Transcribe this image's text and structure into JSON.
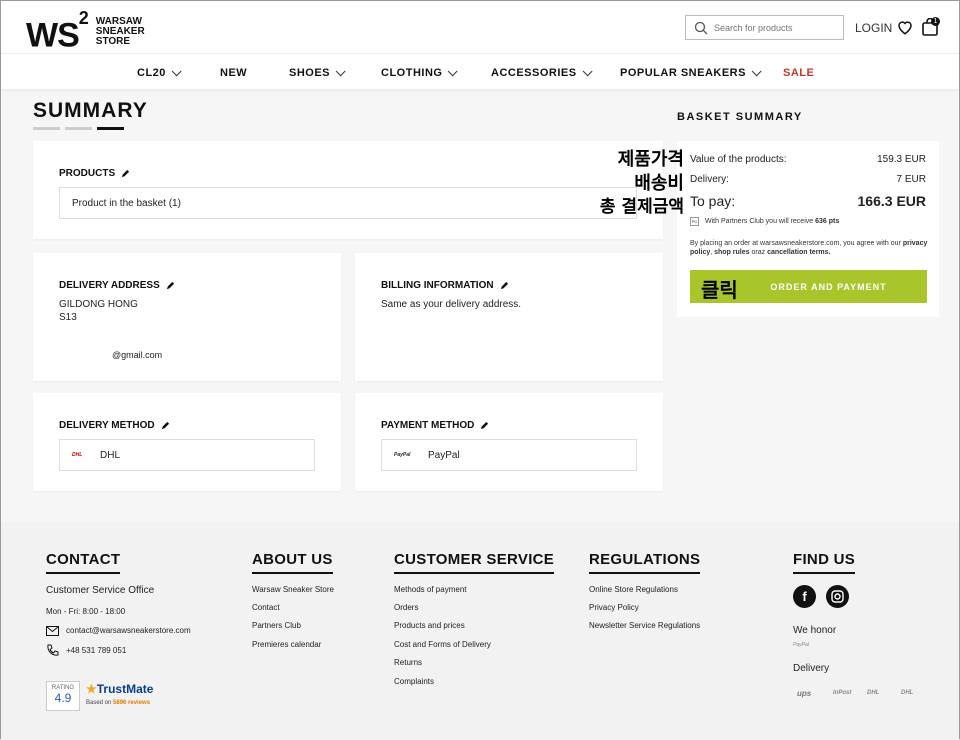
{
  "header": {
    "logo_mark": "WS",
    "logo_sup": "2",
    "logo_line1": "WARSAW",
    "logo_line2": "SNEAKER",
    "logo_line3": "STORE",
    "search_placeholder": "Search for products",
    "login": "LOGIN",
    "cart_count": "1"
  },
  "nav": {
    "items": [
      "CL20",
      "NEW",
      "SHOES",
      "CLOTHING",
      "ACCESSORIES",
      "POPULAR SNEAKERS",
      "SALE"
    ]
  },
  "summary": {
    "title": "SUMMARY",
    "products_title": "PRODUCTS",
    "products_box": "Product in the basket (1)",
    "delivery_address_title": "DELIVERY ADDRESS",
    "delivery_name": "GILDONG HONG",
    "delivery_line2": "S13",
    "delivery_email": "@gmail.com",
    "billing_title": "BILLING INFORMATION",
    "billing_text": "Same as your delivery address.",
    "delivery_method_title": "DELIVERY METHOD",
    "delivery_method_logo": "DHL",
    "delivery_method": "DHL",
    "payment_method_title": "PAYMENT METHOD",
    "payment_method_logo": "PayPal",
    "payment_method": "PayPal"
  },
  "basket": {
    "title": "BASKET SUMMARY",
    "value_label": "Value of the products:",
    "value_amount": "159.3 EUR",
    "delivery_label": "Delivery:",
    "delivery_amount": "7 EUR",
    "topay_label": "To pay:",
    "topay_amount": "166.3 EUR",
    "pc_icon": "PC",
    "partners_note_prefix": "With Partners Club you will receive",
    "partners_points": "636 pts",
    "agree_prefix": "By placing an order at warsawsneakerstore.com, you agree with our",
    "agree_privacy": "privacy policy",
    "agree_rules": "shop rules",
    "agree_oraz": "oraz",
    "agree_cancel": "cancellation terms.",
    "order_button": "ORDER AND PAYMENT"
  },
  "annotations": {
    "price_kr": "제품가격",
    "shipping_kr": "배송비",
    "total_kr": "총 결제금액",
    "click_kr": "클릭"
  },
  "footer": {
    "contact_title": "CONTACT",
    "contact_office": "Customer Service Office",
    "contact_hours": "Mon - Fri: 8:00 - 18:00",
    "contact_email": "contact@warsawsneakerstore.com",
    "contact_phone": "+48 531 789 051",
    "about_title": "ABOUT US",
    "about_links": [
      "Warsaw Sneaker Store",
      "Contact",
      "Partners Club",
      "Premieres calendar"
    ],
    "cs_title": "CUSTOMER SERVICE",
    "cs_links": [
      "Methods of payment",
      "Orders",
      "Products and prices",
      "Cost and Forms of Delivery",
      "Returns",
      "Complaints"
    ],
    "reg_title": "REGULATIONS",
    "reg_links": [
      "Online Store Regulations",
      "Privacy Policy",
      "Newsletter Service Regulations"
    ],
    "find_title": "FIND US",
    "we_honor": "We honor",
    "paypal_small": "PayPal",
    "delivery_label": "Delivery",
    "carriers": [
      "ups",
      "InPost",
      "DHL",
      "DHL"
    ],
    "rating_label": "RATING",
    "rating_value": "4.9",
    "trustmate": "TrustMate",
    "trust_prefix": "Based on",
    "trust_reviews": "5896 reviews"
  }
}
